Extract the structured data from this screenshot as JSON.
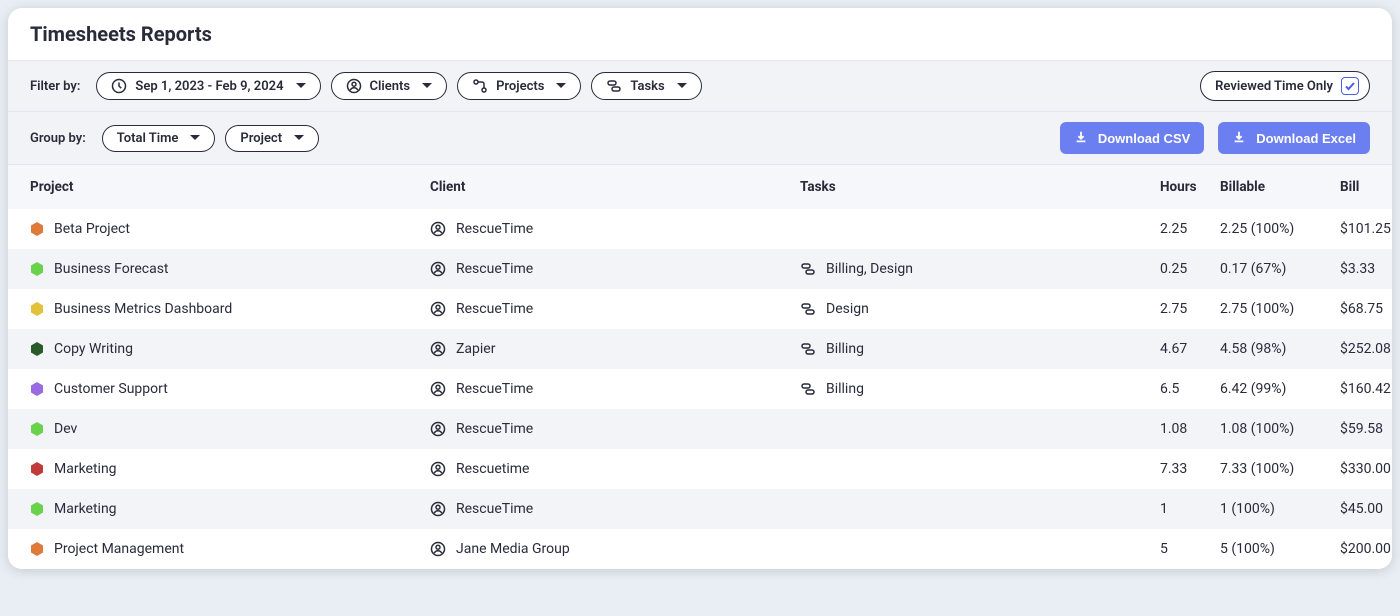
{
  "header": {
    "title": "Timesheets Reports"
  },
  "filters": {
    "label": "Filter by:",
    "date_range": "Sep 1, 2023 - Feb 9, 2024",
    "clients_label": "Clients",
    "projects_label": "Projects",
    "tasks_label": "Tasks",
    "reviewed_label": "Reviewed Time Only"
  },
  "grouping": {
    "label": "Group by:",
    "total_time_label": "Total Time",
    "project_label": "Project"
  },
  "actions": {
    "download_csv": "Download CSV",
    "download_excel": "Download Excel"
  },
  "table": {
    "columns": {
      "project": "Project",
      "client": "Client",
      "tasks": "Tasks",
      "hours": "Hours",
      "billable": "Billable",
      "bill": "Bill"
    },
    "rows": [
      {
        "color": "#e07a3b",
        "project": "Beta Project",
        "client": "RescueTime",
        "tasks": "",
        "hours": "2.25",
        "billable": "2.25 (100%)",
        "bill": "$101.25"
      },
      {
        "color": "#6ad24a",
        "project": "Business Forecast",
        "client": "RescueTime",
        "tasks": "Billing, Design",
        "hours": "0.25",
        "billable": "0.17 (67%)",
        "bill": "$3.33"
      },
      {
        "color": "#e0c23b",
        "project": "Business Metrics Dashboard",
        "client": "RescueTime",
        "tasks": "Design",
        "hours": "2.75",
        "billable": "2.75 (100%)",
        "bill": "$68.75"
      },
      {
        "color": "#2a5a2a",
        "project": "Copy Writing",
        "client": "Zapier",
        "tasks": "Billing",
        "hours": "4.67",
        "billable": "4.58 (98%)",
        "bill": "$252.08"
      },
      {
        "color": "#9a6ae0",
        "project": "Customer Support",
        "client": "RescueTime",
        "tasks": "Billing",
        "hours": "6.5",
        "billable": "6.42 (99%)",
        "bill": "$160.42"
      },
      {
        "color": "#6ad24a",
        "project": "Dev",
        "client": "RescueTime",
        "tasks": "",
        "hours": "1.08",
        "billable": "1.08 (100%)",
        "bill": "$59.58"
      },
      {
        "color": "#c23b3b",
        "project": "Marketing",
        "client": "Rescuetime",
        "tasks": "",
        "hours": "7.33",
        "billable": "7.33 (100%)",
        "bill": "$330.00"
      },
      {
        "color": "#6ad24a",
        "project": "Marketing",
        "client": "RescueTime",
        "tasks": "",
        "hours": "1",
        "billable": "1 (100%)",
        "bill": "$45.00"
      },
      {
        "color": "#e07a3b",
        "project": "Project Management",
        "client": "Jane Media Group",
        "tasks": "",
        "hours": "5",
        "billable": "5 (100%)",
        "bill": "$200.00"
      }
    ]
  }
}
